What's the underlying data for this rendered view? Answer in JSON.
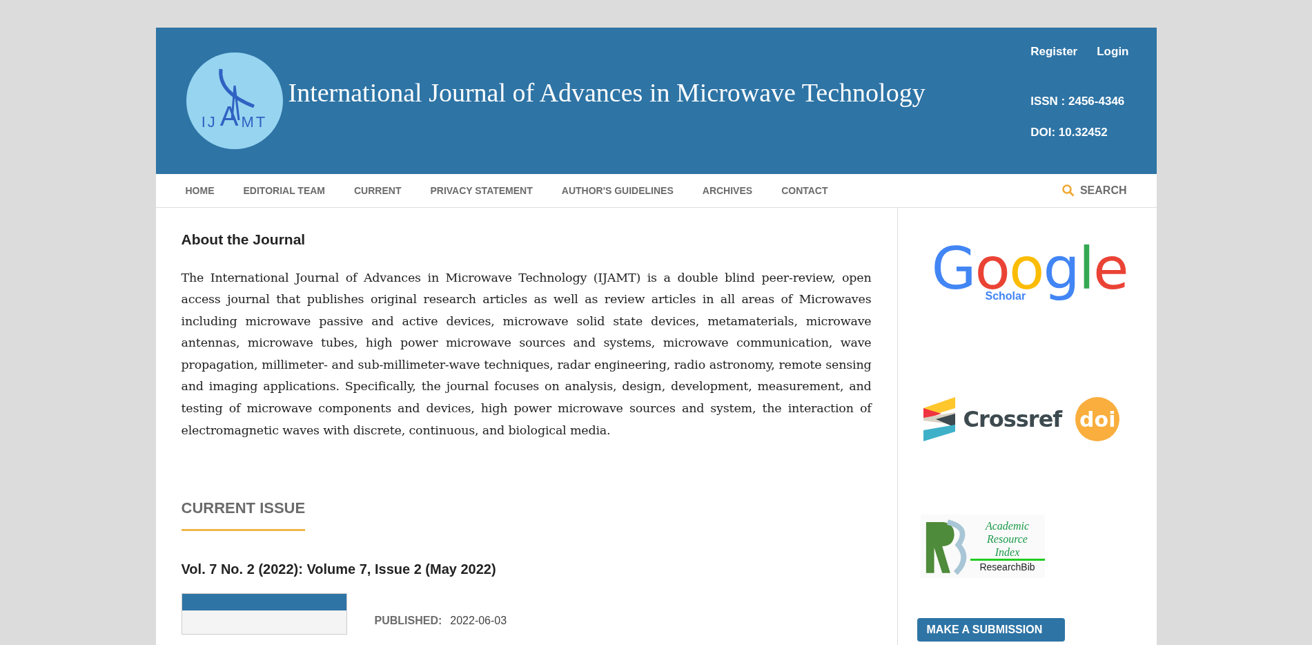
{
  "header": {
    "logo_letters": [
      "IJ",
      "A",
      "MT"
    ],
    "title": "International Journal of Advances in Microwave Technology",
    "user_links": [
      "Register",
      "Login"
    ],
    "issn": "ISSN : 2456-4346",
    "doi": "DOI: 10.32452"
  },
  "nav": {
    "items": [
      {
        "label": "HOME"
      },
      {
        "label": "EDITORIAL TEAM"
      },
      {
        "label": "CURRENT"
      },
      {
        "label": "PRIVACY STATEMENT"
      },
      {
        "label": "AUTHOR'S GUIDELINES"
      },
      {
        "label": "ARCHIVES"
      },
      {
        "label": "CONTACT"
      }
    ],
    "search": "SEARCH"
  },
  "about": {
    "heading": "About the Journal",
    "text": "The International Journal of Advances in Microwave Technology (IJAMT) is a double blind peer-review, open access journal that publishes original research articles as well as review articles in all areas of Microwaves including microwave passive and active devices, microwave solid state devices, metamaterials,  microwave antennas, microwave tubes, high power microwave sources and systems, microwave communication, wave propagation, millimeter- and sub-millimeter-wave techniques, radar engineering, radio astronomy, remote sensing and imaging applications. Specifically, the journal focuses on analysis, design, development, measurement, and testing of microwave components and devices, high power microwave sources and system, the interaction of electromagnetic waves with discrete, continuous, and biological media."
  },
  "current_issue": {
    "heading": "CURRENT ISSUE",
    "title": "Vol. 7 No. 2 (2022): Volume 7, Issue 2 (May 2022)",
    "published_label": "PUBLISHED:",
    "published_date": "2022-06-03"
  },
  "sidebar": {
    "logos": [
      {
        "kind": "google",
        "letters": [
          {
            "text": "G",
            "color": "#4285f4"
          },
          {
            "text": "o",
            "color": "#ea4335"
          },
          {
            "text": "o",
            "color": "#fbbc05"
          },
          {
            "text": "g",
            "color": "#4285f4"
          },
          {
            "text": "l",
            "color": "#34a853"
          },
          {
            "text": "e",
            "color": "#ea4335"
          }
        ],
        "sub": "Scholar"
      },
      {
        "kind": "crossref",
        "name": "Crossref",
        "badge": "doi"
      },
      {
        "kind": "researchbib",
        "lines": [
          "Academic",
          "Resource",
          "Index"
        ],
        "sub": "ResearchBib"
      }
    ],
    "button": "MAKE A SUBMISSION"
  }
}
